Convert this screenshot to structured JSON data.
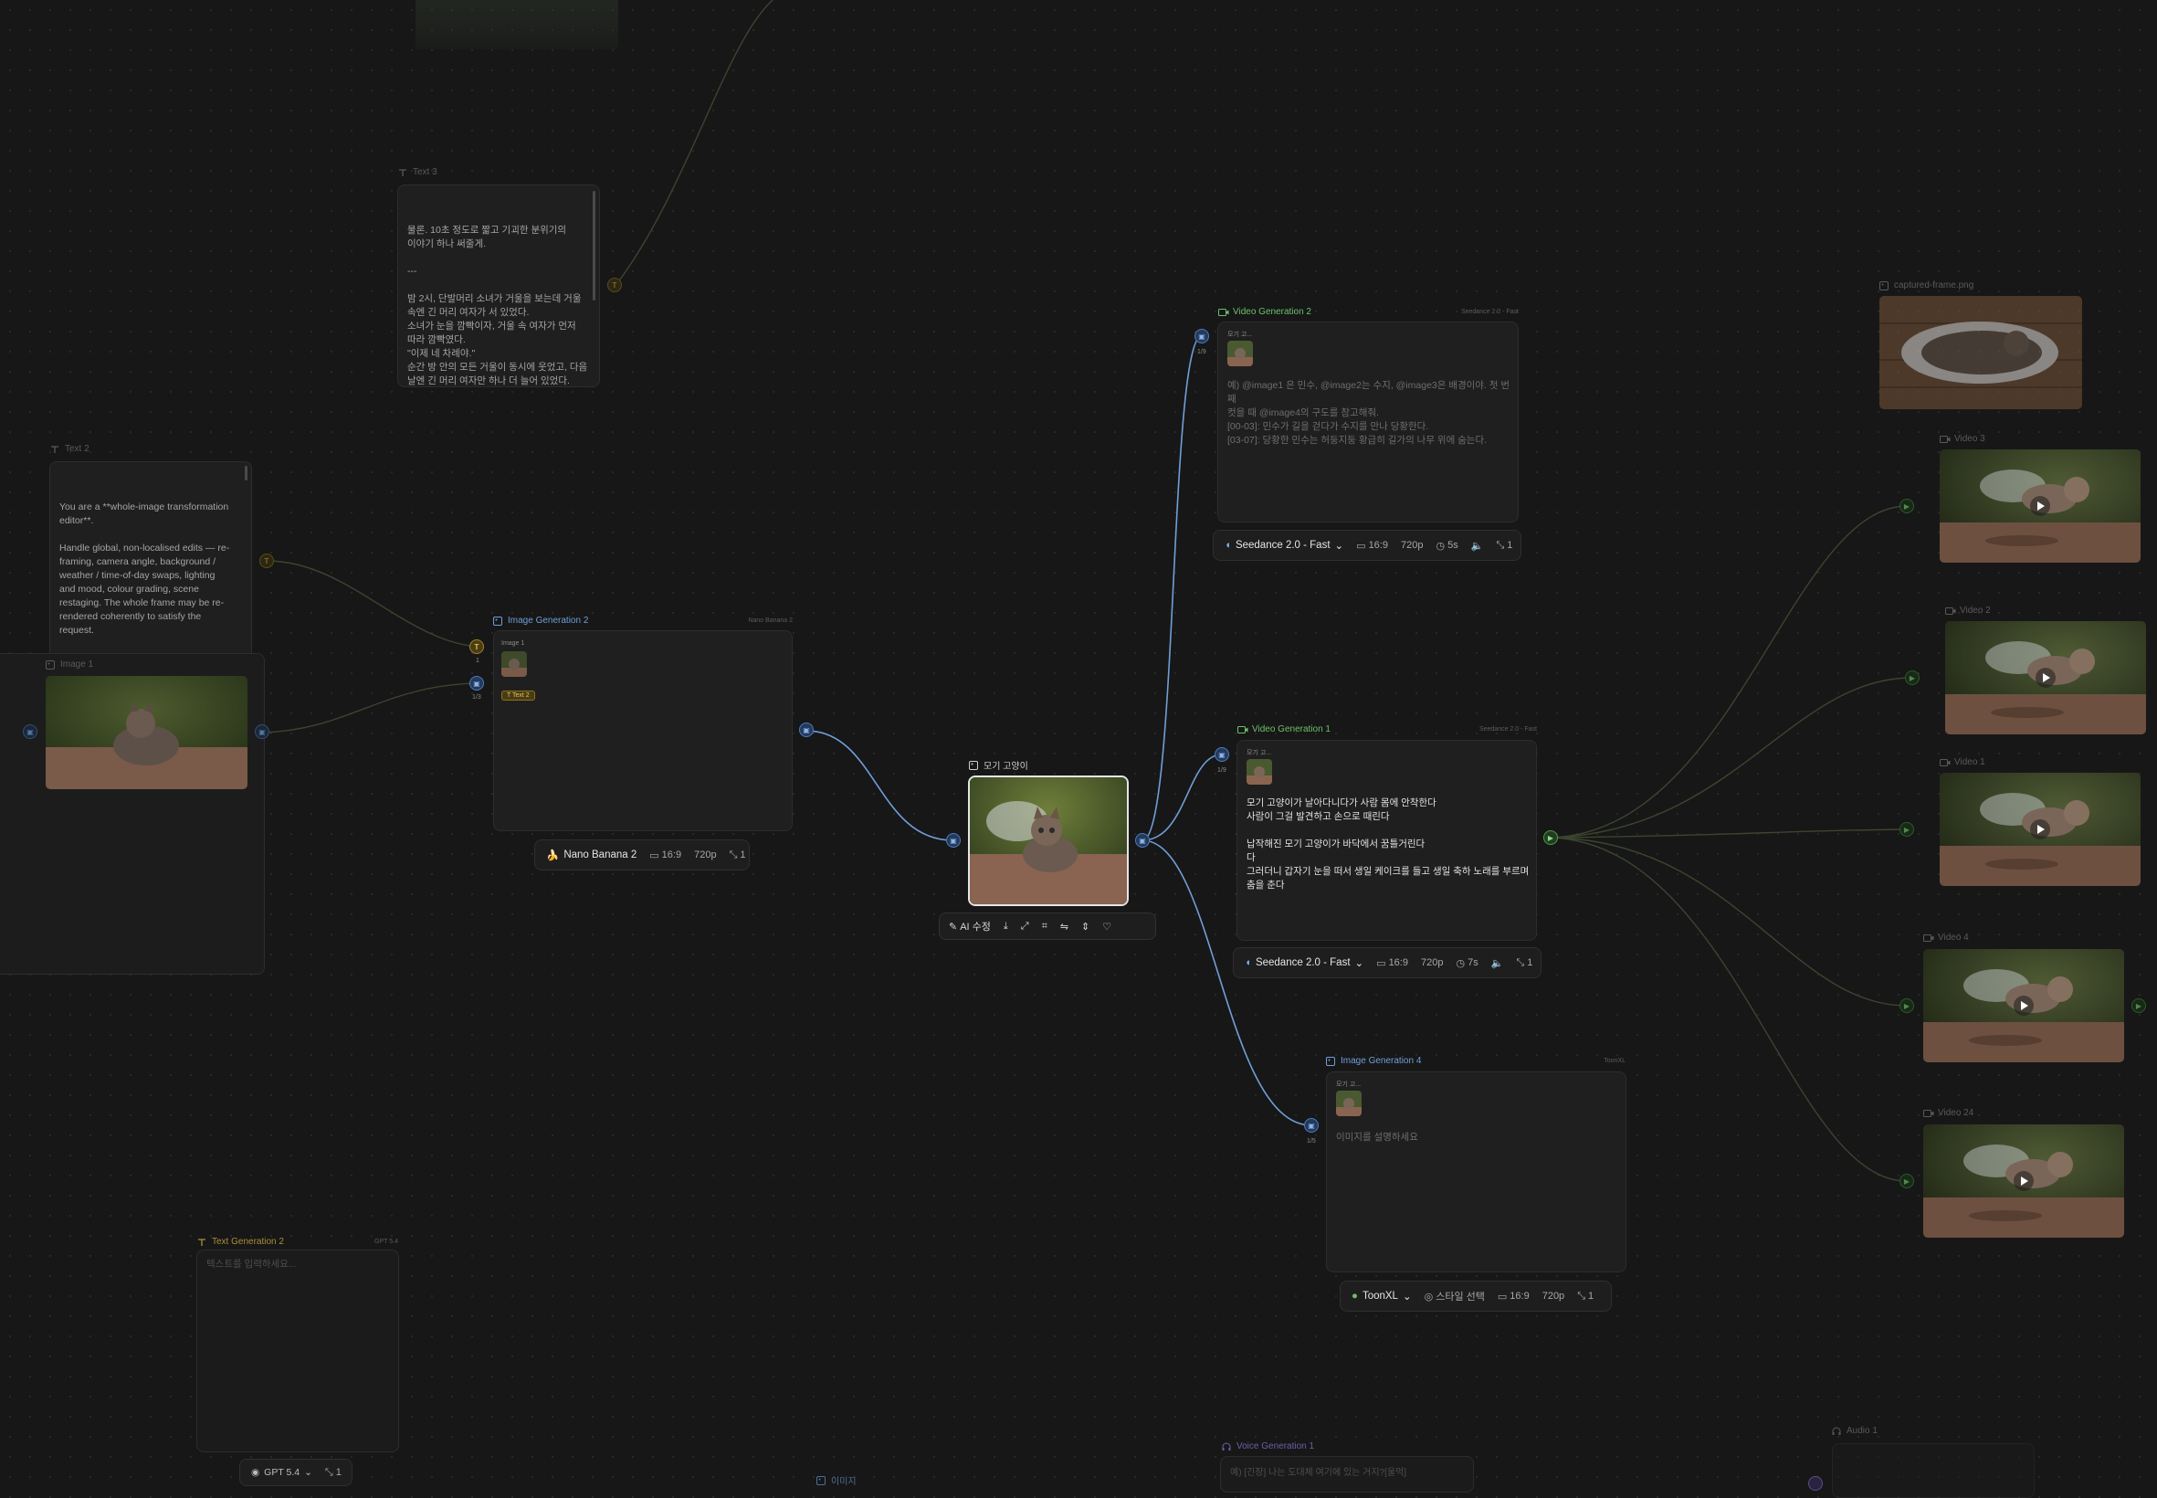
{
  "colors": {
    "canvas": "#171717",
    "wire_blue": "#6f9fd8",
    "wire_dim": "#3f4a33",
    "accent_green": "#6fbf6a",
    "accent_yellow": "#a98f3a"
  },
  "nodes": {
    "text3": {
      "title": "Text 3",
      "content": "물론. 10초 정도로 짧고 기괴한 분위기의\n이야기 하나 써줄게.\n\n---\n\n밤 2시, 단발머리 소녀가 거울을 보는데 거울\n속엔 긴 머리 여자가 서 있었다.\n소녀가 눈을 깜빡이자, 거울 속 여자가 먼저\n따라 깜빡였다.\n\"이제 네 차례야.\"\n순간 방 안의 모든 거울이 동시에 웃었고, 다음\n날엔 긴 머리 여자만 하나 더 늘어 있었다.\n\n---"
    },
    "text2": {
      "title": "Text 2",
      "content": "You are a **whole-image transformation\neditor**.\n\nHandle global, non-localised edits — re-\nframing, camera angle, background /\nweather / time-of-day swaps, lighting\nand mood, colour grading, scene\nrestaging. The whole frame may be re-\nrendered coherently to satisfy the\nrequest.\n\n----------------------------------------------------\n--------------------\nINPUT : one clean image + text"
    },
    "image1": {
      "title": "Image 1"
    },
    "image_gen2": {
      "title": "Image Generation 2",
      "model_tag": "Nano Banana 2",
      "ref_label": "Image 1",
      "tag": "Text 2",
      "port_text_count": "1",
      "port_image_count": "1/3",
      "toolbar": {
        "model": "Nano Banana 2",
        "ratio": "16:9",
        "res": "720p",
        "count": "1"
      }
    },
    "cat_image": {
      "title": "모기 고양이",
      "ai_edit": "AI 수정"
    },
    "video_gen2": {
      "title": "Video Generation 2",
      "model_tag": "Seedance 2.0 - Fast",
      "ref_label": "모기 고...",
      "port_count": "1/9",
      "prompt": "예) @image1 은 민수, @image2는 수지, @image3은 배경이야. 첫 번째\n컷을 때 @image4의 구도를 참고해줘.\n[00-03]: 민수가 길을 걷다가 수지를 만나 당황한다.\n[03-07]: 당황한 민수는 허둥지둥 황급히 길가의 나무 위에 숨는다.",
      "toolbar": {
        "model": "Seedance 2.0 - Fast",
        "ratio": "16:9",
        "res": "720p",
        "dur": "5s",
        "count": "1"
      }
    },
    "video_gen1": {
      "title": "Video Generation 1",
      "model_tag": "Seedance 2.0 - Fast",
      "ref_label": "모기 고...",
      "port_count": "1/9",
      "prompt": "모기 고양이가 날아다니다가 사람 몸에 안착한다\n사람이 그걸 발견하고 손으로 때린다\n\n납작해진 모기 고양이가 바닥에서 꿈틀거린다\n다\n그러더니 갑자기 눈을 떠서 생일 케이크를 들고 생일 축하 노래를 부르며\n춤을 춘다",
      "toolbar": {
        "model": "Seedance 2.0 - Fast",
        "ratio": "16:9",
        "res": "720p",
        "dur": "7s",
        "count": "1"
      }
    },
    "image_gen4": {
      "title": "Image Generation 4",
      "model_tag": "ToonXL",
      "ref_label": "모기 고...",
      "port_count": "1/5",
      "placeholder": "이미지를 설명하세요",
      "toolbar": {
        "model": "ToonXL",
        "style": "스타일 선택",
        "ratio": "16:9",
        "res": "720p",
        "count": "1"
      }
    },
    "text_gen2": {
      "title": "Text Generation 2",
      "model_tag": "GPT 5.4",
      "placeholder": "텍스트를 입력하세요...",
      "toolbar": {
        "model": "GPT 5.4",
        "count": "1"
      }
    },
    "captured": {
      "title": "captured-frame.png"
    },
    "videos": [
      {
        "title": "Video 3"
      },
      {
        "title": "Video 2"
      },
      {
        "title": "Video 1"
      },
      {
        "title": "Video 4"
      },
      {
        "title": "Video 24"
      }
    ],
    "voice_gen1": {
      "title": "Voice Generation 1",
      "placeholder": "예) [긴장] 나는 도대체 여기에 있는 거지?[울먹]"
    },
    "audio1": {
      "title": "Audio 1"
    },
    "image_bottom": {
      "title": "이미지"
    }
  }
}
